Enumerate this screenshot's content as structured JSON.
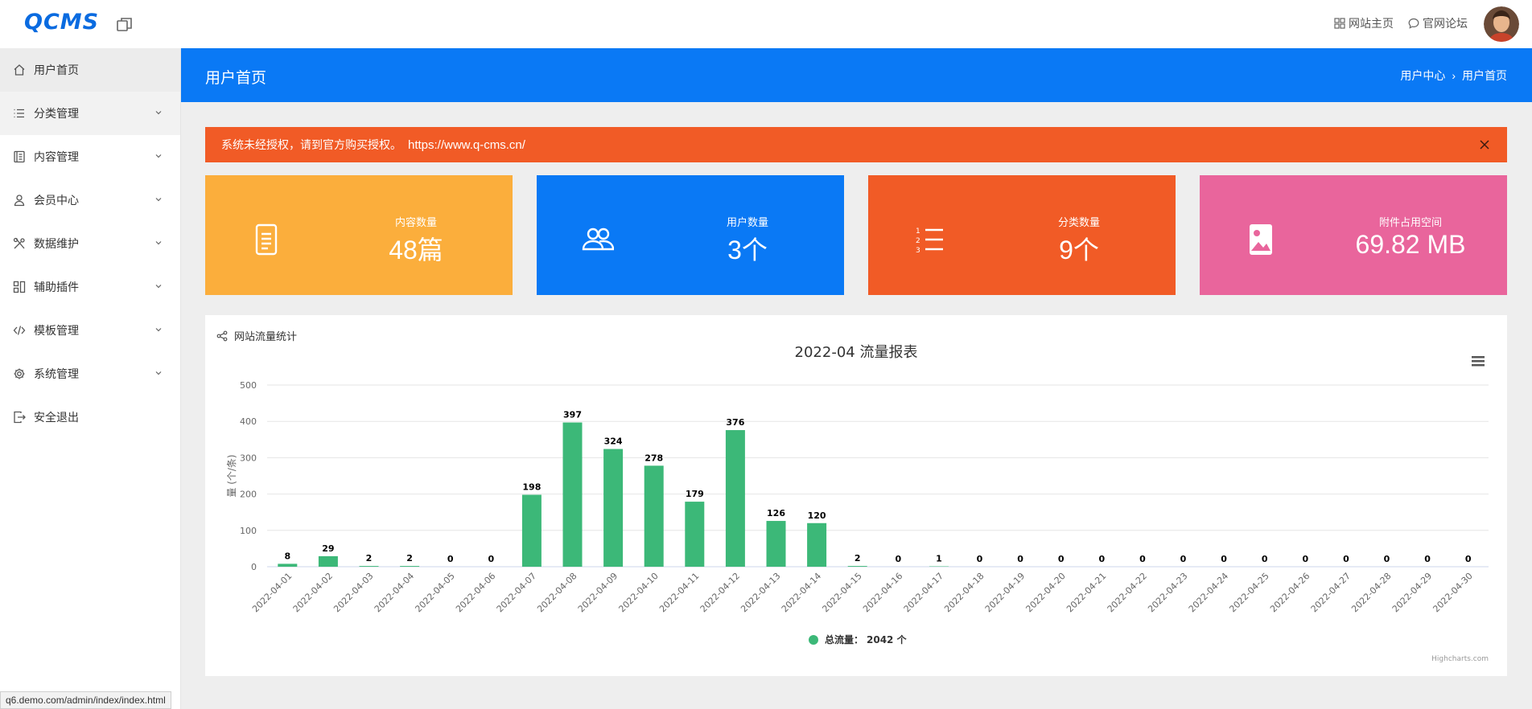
{
  "app": {
    "logo_text": "QCMS",
    "top_links": [
      {
        "label": "网站主页",
        "icon": "grid-icon"
      },
      {
        "label": "官网论坛",
        "icon": "chat-icon"
      }
    ]
  },
  "sidebar": {
    "items": [
      {
        "label": "用户首页",
        "icon": "home-icon",
        "expandable": false
      },
      {
        "label": "分类管理",
        "icon": "list-icon",
        "expandable": true
      },
      {
        "label": "内容管理",
        "icon": "document-icon",
        "expandable": true
      },
      {
        "label": "会员中心",
        "icon": "user-icon",
        "expandable": true
      },
      {
        "label": "数据维护",
        "icon": "tools-icon",
        "expandable": true
      },
      {
        "label": "辅助插件",
        "icon": "plugin-icon",
        "expandable": true
      },
      {
        "label": "模板管理",
        "icon": "code-icon",
        "expandable": true
      },
      {
        "label": "系统管理",
        "icon": "gear-icon",
        "expandable": true
      },
      {
        "label": "安全退出",
        "icon": "logout-icon",
        "expandable": false
      }
    ]
  },
  "header": {
    "title": "用户首页",
    "breadcrumb": [
      "用户中心",
      "用户首页"
    ]
  },
  "alert": {
    "message": "系统未经授权，请到官方购买授权。",
    "url": "https://www.q-cms.cn/"
  },
  "stats": [
    {
      "label": "内容数量",
      "value": "48篇",
      "icon": "document-icon",
      "color": "#fbae3c"
    },
    {
      "label": "用户数量",
      "value": "3个",
      "icon": "users-icon",
      "color": "#0a79f5"
    },
    {
      "label": "分类数量",
      "value": "9个",
      "icon": "numbered-list-icon",
      "color": "#f15b26"
    },
    {
      "label": "附件占用空间",
      "value": "69.82 MB",
      "icon": "image-icon",
      "color": "#e9659c"
    }
  ],
  "panel": {
    "title": "网站流量统计"
  },
  "chart_data": {
    "type": "bar",
    "title": "2022-04 流量报表",
    "ylabel": "量 (个/条)",
    "ylim": [
      0,
      500
    ],
    "yticks": [
      0,
      100,
      200,
      300,
      400,
      500
    ],
    "categories": [
      "2022-04-01",
      "2022-04-02",
      "2022-04-03",
      "2022-04-04",
      "2022-04-05",
      "2022-04-06",
      "2022-04-07",
      "2022-04-08",
      "2022-04-09",
      "2022-04-10",
      "2022-04-11",
      "2022-04-12",
      "2022-04-13",
      "2022-04-14",
      "2022-04-15",
      "2022-04-16",
      "2022-04-17",
      "2022-04-18",
      "2022-04-19",
      "2022-04-20",
      "2022-04-21",
      "2022-04-22",
      "2022-04-23",
      "2022-04-24",
      "2022-04-25",
      "2022-04-26",
      "2022-04-27",
      "2022-04-28",
      "2022-04-29",
      "2022-04-30"
    ],
    "series": [
      {
        "name": "总流量",
        "color": "#3cb878",
        "values": [
          8,
          29,
          2,
          2,
          0,
          0,
          198,
          397,
          324,
          278,
          179,
          376,
          126,
          120,
          2,
          0,
          1,
          0,
          0,
          0,
          0,
          0,
          0,
          0,
          0,
          0,
          0,
          0,
          0,
          0
        ]
      }
    ],
    "legend_total": "2042 个",
    "legend_position": "bottom-center",
    "grid": true,
    "credits": "Highcharts.com"
  },
  "status": {
    "url": "q6.demo.com/admin/index/index.html"
  }
}
